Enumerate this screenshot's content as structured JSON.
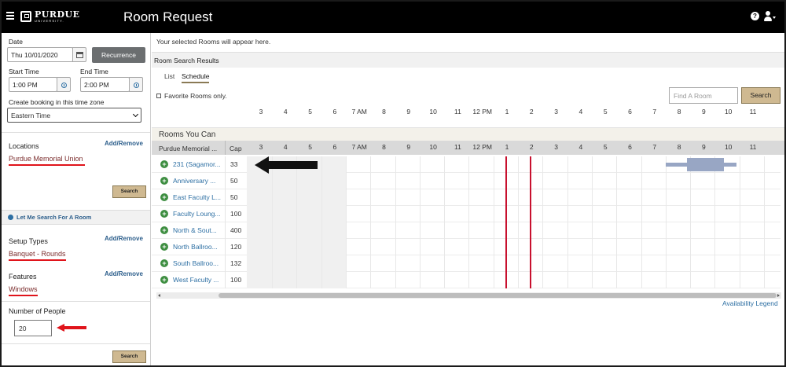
{
  "header": {
    "brand": "PURDUE",
    "brand_sub": "UNIVERSITY.",
    "title": "Room Request"
  },
  "booking": {
    "date_label": "Date",
    "date_value": "Thu 10/01/2020",
    "recurrence_label": "Recurrence",
    "start_label": "Start Time",
    "start_value": "1:00 PM",
    "end_label": "End Time",
    "end_value": "2:00 PM",
    "timezone_label": "Create booking in this time zone",
    "timezone_value": "Eastern Time"
  },
  "locations": {
    "title": "Locations",
    "add_remove": "Add/Remove",
    "value": "Purdue Memorial Union",
    "search_label": "Search"
  },
  "let_me_search": "Let Me Search For A Room",
  "setup_types": {
    "title": "Setup Types",
    "add_remove": "Add/Remove",
    "value": "Banquet - Rounds"
  },
  "features": {
    "title": "Features",
    "add_remove": "Add/Remove",
    "value": "Windows"
  },
  "people": {
    "title": "Number of People",
    "value": "20",
    "search_label": "Search"
  },
  "results": {
    "selected_note": "Your selected Rooms will appear here.",
    "title": "Room Search Results",
    "tabs": [
      "List",
      "Schedule"
    ],
    "active_tab": "Schedule",
    "favorite_label": "Favorite Rooms only.",
    "find_placeholder": "Find A Room",
    "search_label": "Search",
    "hours": [
      "3",
      "4",
      "5",
      "6",
      "7 AM",
      "8",
      "9",
      "10",
      "11",
      "12 PM",
      "1",
      "2",
      "3",
      "4",
      "5",
      "6",
      "7",
      "8",
      "9",
      "10",
      "11"
    ],
    "rooms_you_can": "Rooms You Can",
    "column_room": "Purdue Memorial ...",
    "column_cap": "Cap",
    "rooms": [
      {
        "name": "231 (Sagamor...",
        "cap": "33"
      },
      {
        "name": "Anniversary ...",
        "cap": "50"
      },
      {
        "name": "East Faculty L...",
        "cap": "50"
      },
      {
        "name": "Faculty Loung...",
        "cap": "100"
      },
      {
        "name": "North & Sout...",
        "cap": "400"
      },
      {
        "name": "North Ballroo...",
        "cap": "120"
      },
      {
        "name": "South Ballroo...",
        "cap": "132"
      },
      {
        "name": "West Faculty ...",
        "cap": "100"
      }
    ],
    "legend_link": "Availability Legend"
  },
  "colors": {
    "accent_gold": "#cfb991",
    "link_blue": "#2d6fa3",
    "annotation_red": "#e0141b",
    "marker_red": "#c8102e"
  }
}
